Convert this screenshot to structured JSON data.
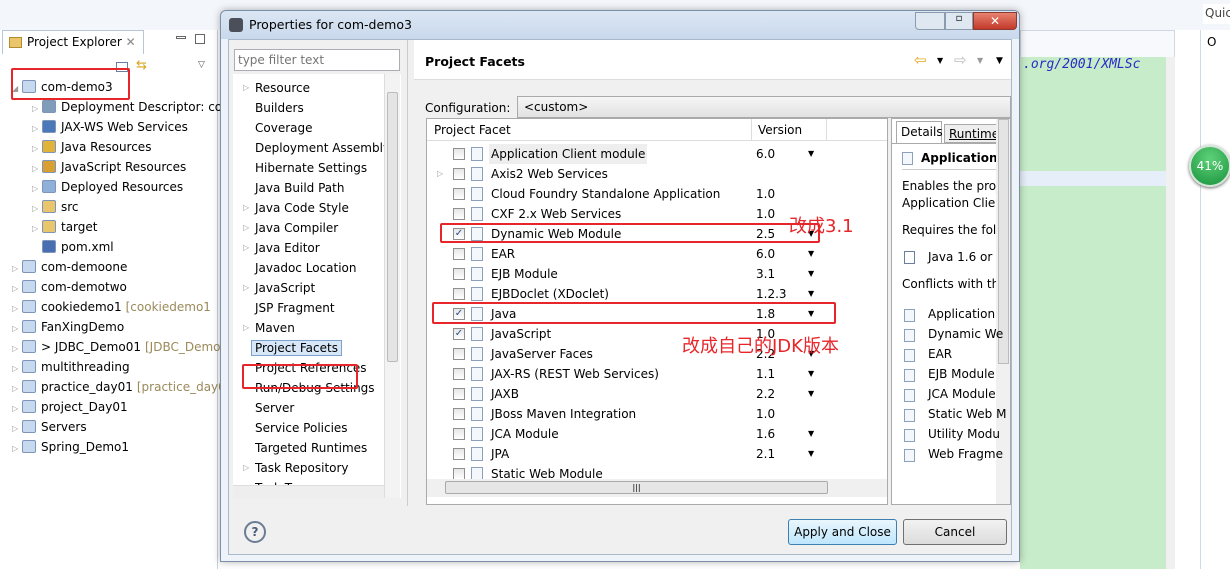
{
  "explorer": {
    "tab": "Project Explorer",
    "items": [
      {
        "label": "com-demo3",
        "level": 0,
        "expanded": true
      },
      {
        "label": "Deployment Descriptor: co",
        "level": 1
      },
      {
        "label": "JAX-WS Web Services",
        "level": 1
      },
      {
        "label": "Java Resources",
        "level": 1
      },
      {
        "label": "JavaScript Resources",
        "level": 1
      },
      {
        "label": "Deployed Resources",
        "level": 1
      },
      {
        "label": "src",
        "level": 1
      },
      {
        "label": "target",
        "level": 1
      },
      {
        "label": "pom.xml",
        "level": 1,
        "leaf": true
      },
      {
        "label": "com-demoone",
        "level": 0
      },
      {
        "label": "com-demotwo",
        "level": 0
      },
      {
        "label": "cookiedemo1",
        "suffix": "[cookiedemo1",
        "level": 0
      },
      {
        "label": "FanXingDemo",
        "level": 0
      },
      {
        "label": "> JDBC_Demo01",
        "suffix": "[JDBC_Demo",
        "level": 0
      },
      {
        "label": "multithreading",
        "level": 0
      },
      {
        "label": "practice_day01",
        "suffix": "[practice_day0",
        "level": 0
      },
      {
        "label": "project_Day01",
        "level": 0
      },
      {
        "label": "Servers",
        "level": 0
      },
      {
        "label": "Spring_Demo1",
        "level": 0
      }
    ]
  },
  "editor": {
    "text": ".org/2001/XMLSc"
  },
  "right_panel": {
    "quick": "Quic",
    "outline": "O"
  },
  "progress": {
    "label": "41%",
    "value": 41
  },
  "dialog": {
    "title": "Properties for com-demo3",
    "filter_placeholder": "type filter text",
    "nav": [
      {
        "label": "Resource",
        "arrow": true
      },
      {
        "label": "Builders"
      },
      {
        "label": "Coverage"
      },
      {
        "label": "Deployment Assembly"
      },
      {
        "label": "Hibernate Settings"
      },
      {
        "label": "Java Build Path"
      },
      {
        "label": "Java Code Style",
        "arrow": true
      },
      {
        "label": "Java Compiler",
        "arrow": true
      },
      {
        "label": "Java Editor",
        "arrow": true
      },
      {
        "label": "Javadoc Location"
      },
      {
        "label": "JavaScript",
        "arrow": true
      },
      {
        "label": "JSP Fragment"
      },
      {
        "label": "Maven",
        "arrow": true
      },
      {
        "label": "Project Facets",
        "selected": true
      },
      {
        "label": "Project References"
      },
      {
        "label": "Run/Debug Settings"
      },
      {
        "label": "Server"
      },
      {
        "label": "Service Policies"
      },
      {
        "label": "Targeted Runtimes"
      },
      {
        "label": "Task Repository",
        "arrow": true
      },
      {
        "label": "Task Tags"
      }
    ],
    "page_title": "Project Facets",
    "configuration_label": "Configuration:",
    "configuration_value": "<custom>",
    "table": {
      "col_facet": "Project Facet",
      "col_version": "Version",
      "rows": [
        {
          "name": "Application Client module",
          "version": "6.0",
          "checked": false,
          "dropdown": true
        },
        {
          "name": "Axis2 Web Services",
          "version": "",
          "checked": false,
          "expand": true
        },
        {
          "name": "Cloud Foundry Standalone Application",
          "version": "1.0",
          "checked": false
        },
        {
          "name": "CXF 2.x Web Services",
          "version": "1.0",
          "checked": false
        },
        {
          "name": "Dynamic Web Module",
          "version": "2.5",
          "checked": true,
          "dropdown": true
        },
        {
          "name": "EAR",
          "version": "6.0",
          "checked": false,
          "dropdown": true
        },
        {
          "name": "EJB Module",
          "version": "3.1",
          "checked": false,
          "dropdown": true
        },
        {
          "name": "EJBDoclet (XDoclet)",
          "version": "1.2.3",
          "checked": false,
          "dropdown": true
        },
        {
          "name": "Java",
          "version": "1.8",
          "checked": true,
          "dropdown": true
        },
        {
          "name": "JavaScript",
          "version": "1.0",
          "checked": true
        },
        {
          "name": "JavaServer Faces",
          "version": "2.2",
          "checked": false,
          "dropdown": true
        },
        {
          "name": "JAX-RS (REST Web Services)",
          "version": "1.1",
          "checked": false,
          "dropdown": true
        },
        {
          "name": "JAXB",
          "version": "2.2",
          "checked": false,
          "dropdown": true
        },
        {
          "name": "JBoss Maven Integration",
          "version": "1.0",
          "checked": false
        },
        {
          "name": "JCA Module",
          "version": "1.6",
          "checked": false,
          "dropdown": true
        },
        {
          "name": "JPA",
          "version": "2.1",
          "checked": false,
          "dropdown": true
        },
        {
          "name": "Static Web Module",
          "version": "",
          "checked": false
        }
      ]
    },
    "details": {
      "tab_details": "Details",
      "tab_runtimes": "Runtime",
      "heading": "Application",
      "desc1": "Enables the proj",
      "desc2": "Application Clien",
      "requires": "Requires the foll",
      "req_item": "Java 1.6 or n",
      "conflicts": "Conflicts with the",
      "conflict_items": [
        "Application",
        "Dynamic We",
        "EAR",
        "EJB Module",
        "JCA Module",
        "Static Web M",
        "Utility Modu",
        "Web Fragme"
      ]
    },
    "annotations": {
      "dwm": "改成3.1",
      "java": "改成自己的JDK版本"
    },
    "apply_close": "Apply and Close",
    "cancel": "Cancel"
  }
}
